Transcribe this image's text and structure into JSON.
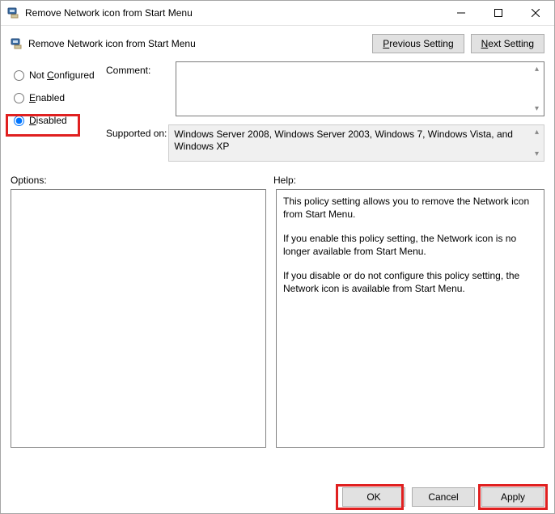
{
  "window": {
    "title": "Remove Network icon from Start Menu"
  },
  "subheader": {
    "policy_title": "Remove Network icon from Start Menu",
    "prev_label_pre": "P",
    "prev_label_post": "revious Setting",
    "next_label_pre": "N",
    "next_label_post": "ext Setting"
  },
  "radios": {
    "not_configured_pre": "Not ",
    "not_configured_ul": "C",
    "not_configured_post": "onfigured",
    "enabled_ul": "E",
    "enabled_post": "nabled",
    "disabled_ul": "D",
    "disabled_post": "isabled",
    "selected": "disabled"
  },
  "fields": {
    "comment_label": "Comment:",
    "comment_value": "",
    "supported_label": "Supported on:",
    "supported_value": "Windows Server 2008, Windows Server 2003, Windows 7, Windows Vista, and Windows XP"
  },
  "lower": {
    "options_label": "Options:",
    "help_label": "Help:",
    "help_p1": "This policy setting allows you to remove the Network icon from Start Menu.",
    "help_p2": "If you enable this policy setting, the Network icon is no longer available from Start Menu.",
    "help_p3": "If you disable or do not configure this policy setting, the Network icon is available from Start Menu."
  },
  "buttons": {
    "ok": "OK",
    "cancel": "Cancel",
    "apply": "Apply"
  }
}
